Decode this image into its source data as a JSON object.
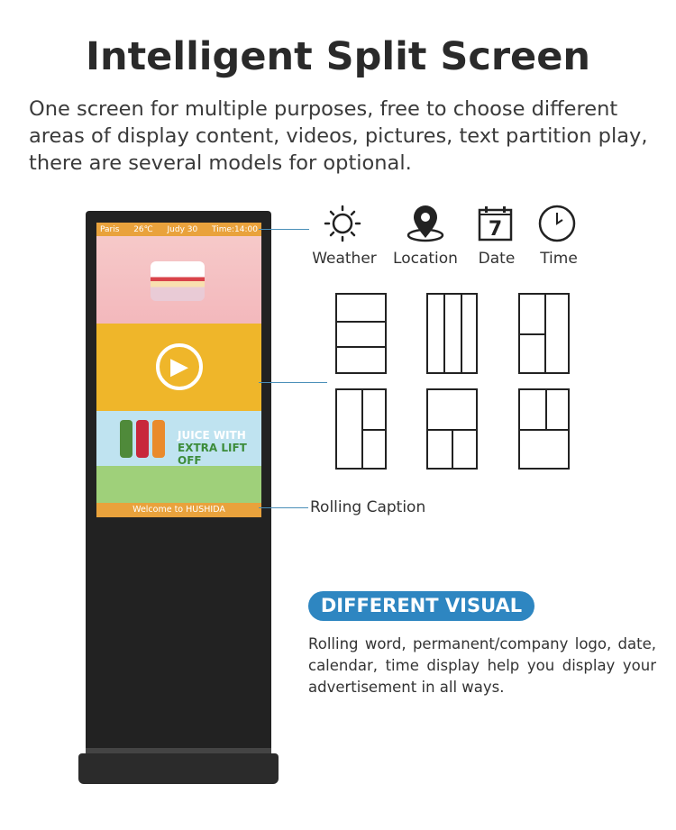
{
  "header": {
    "title": "Intelligent Split Screen",
    "subtitle": "One screen for multiple purposes, free to choose different areas of display content, videos, pictures, text partition play, there are several models for optional."
  },
  "screen": {
    "topbar": {
      "city": "Paris",
      "temp": "26℃",
      "date": "Judy 30",
      "time": "Time:14:00"
    },
    "banner": {
      "line1": "JUICE WITH",
      "line2": "EXTRA LIFT OFF"
    },
    "caption": "Welcome to HUSHIDA"
  },
  "features": [
    {
      "label": "Weather",
      "icon": "sun-icon"
    },
    {
      "label": "Location",
      "icon": "location-pin-icon"
    },
    {
      "label": "Date",
      "icon": "calendar-icon",
      "day": "7"
    },
    {
      "label": "Time",
      "icon": "clock-icon"
    }
  ],
  "callouts": {
    "rolling": "Rolling Caption"
  },
  "visual": {
    "badge": "DIFFERENT VISUAL",
    "text": "Rolling word, permanent/company logo, date, calendar, time display help you display your advertisement in all ways."
  },
  "colors": {
    "accent": "#2e86c1",
    "screen_bar": "#e9a23c"
  }
}
